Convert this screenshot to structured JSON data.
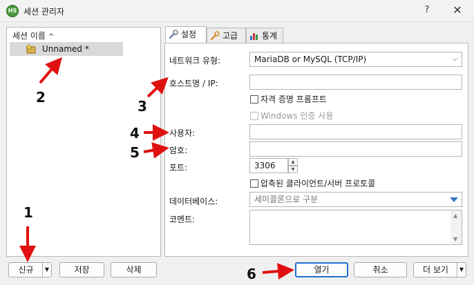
{
  "window": {
    "app_icon_text": "HS",
    "title": "세션 관리자",
    "help_glyph": "?",
    "close_glyph": "✕"
  },
  "sessions": {
    "header": "세션 이름",
    "sort_glyph": "^",
    "items": [
      {
        "label": "Unnamed *",
        "icon": "session-star-icon"
      }
    ]
  },
  "bottom_buttons": {
    "new_label": "신규",
    "save_label": "저장",
    "delete_label": "삭제",
    "open_label": "열기",
    "cancel_label": "취소",
    "more_label": "더 보기"
  },
  "tabs": [
    {
      "label": "설정",
      "icon": "wrench-icon",
      "active": true
    },
    {
      "label": "고급",
      "icon": "wrench-orange-icon",
      "active": false
    },
    {
      "label": "통계",
      "icon": "bar-chart-icon",
      "active": false
    }
  ],
  "settings": {
    "network_type_label": "네트워크 유형:",
    "network_type_value": "MariaDB or MySQL (TCP/IP)",
    "host_label": "호스트명 / IP:",
    "host_value": "",
    "prompt_credentials_label": "자격 증명 프롬프트",
    "windows_auth_label": "Windows 인증 사용",
    "user_label": "사용자:",
    "user_value": "",
    "password_label": "암호:",
    "password_value": "",
    "port_label": "포트:",
    "port_value": "3306",
    "compressed_label": "압축된 클라이언트/서버 프로토콜",
    "database_label": "데이터베이스:",
    "database_placeholder": "세미콜론으로 구분",
    "comment_label": "코멘트:",
    "comment_value": ""
  },
  "annotations": {
    "n1": "1",
    "n2": "2",
    "n3": "3",
    "n4": "4",
    "n5": "5",
    "n6": "6",
    "arrow_color": "#e01010"
  }
}
